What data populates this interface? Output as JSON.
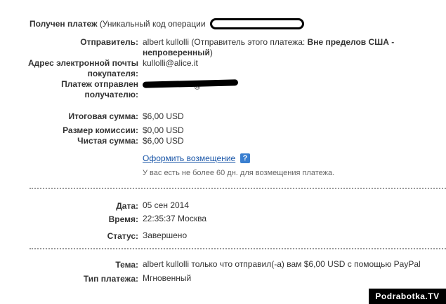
{
  "header": {
    "title": "Получен платеж",
    "code_prefix": "(Уникальный код операции"
  },
  "details": {
    "sender_label": "Отправитель:",
    "sender_value_line1": "albert kullolli (Отправитель этого платежа: ",
    "sender_status_line1": "Вне пределов США -",
    "sender_status_line2": "непроверенный",
    "sender_close": ")",
    "email_label_line1": "Адрес электронной почты",
    "email_label_line2": "покупателя:",
    "email_value": "kullolli@alice.it",
    "recipient_label_line1": "Платеж отправлен",
    "recipient_label_line2": "получателю:",
    "recipient_visible_fragment": "@"
  },
  "amounts": {
    "total_label": "Итоговая сумма:",
    "total_value": "$6,00 USD",
    "fee_label": "Размер комиссии:",
    "fee_value": "$0,00 USD",
    "net_label": "Чистая сумма:",
    "net_value": "$6,00 USD",
    "refund_link": "Оформить возмещение",
    "help_icon_glyph": "?",
    "refund_note": "У вас есть не более 60 дн. для возмещения платежа."
  },
  "status_block": {
    "date_label": "Дата:",
    "date_value": "05 сен 2014",
    "time_label": "Время:",
    "time_value": "22:35:37 Москва",
    "status_label": "Статус:",
    "status_value": "Завершено"
  },
  "payment_block": {
    "subject_label": "Тема:",
    "subject_value": "albert kullolli только что отправил(-а) вам $6,00 USD с помощью PayPal",
    "type_label": "Тип платежа:",
    "type_value": "Мгновенный"
  },
  "watermark": "Podrabotka.TV",
  "colors": {
    "link": "#1a56a8",
    "help_icon": "#3a7fd0",
    "divider": "#9a9a9a"
  }
}
